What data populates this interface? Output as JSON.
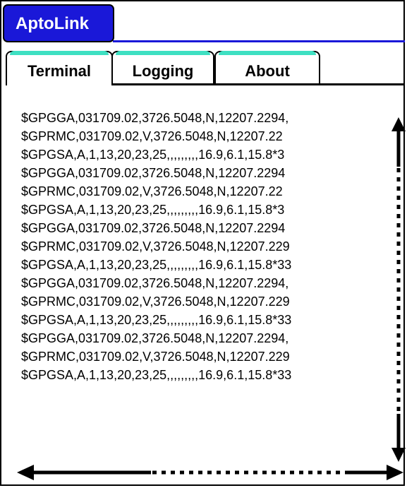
{
  "app": {
    "title": "AptoLink"
  },
  "tabs": [
    {
      "label": "Terminal",
      "active": true
    },
    {
      "label": "Logging",
      "active": false
    },
    {
      "label": "About",
      "active": false
    }
  ],
  "terminal": {
    "lines": [
      "$GPGGA,031709.02,3726.5048,N,12207.2294,",
      "$GPRMC,031709.02,V,3726.5048,N,12207.22",
      "$GPGSA,A,1,13,20,23,25,,,,,,,,,16.9,6.1,15.8*3",
      "$GPGGA,031709.02,3726.5048,N,12207.2294",
      "$GPRMC,031709.02,V,3726.5048,N,12207.22",
      "$GPGSA,A,1,13,20,23,25,,,,,,,,,16.9,6.1,15.8*3",
      "$GPGGA,031709.02,3726.5048,N,12207.2294",
      "$GPRMC,031709.02,V,3726.5048,N,12207.229",
      "$GPGSA,A,1,13,20,23,25,,,,,,,,,16.9,6.1,15.8*33",
      "$GPGGA,031709.02,3726.5048,N,12207.2294,",
      "$GPRMC,031709.02,V,3726.5048,N,12207.229",
      "$GPGSA,A,1,13,20,23,25,,,,,,,,,16.9,6.1,15.8*33",
      "$GPGGA,031709.02,3726.5048,N,12207.2294,",
      "$GPRMC,031709.02,V,3726.5048,N,12207.229",
      "$GPGSA,A,1,13,20,23,25,,,,,,,,,16.9,6.1,15.8*33"
    ]
  },
  "colors": {
    "header_bg": "#1a18d8",
    "tab_accent": "#3ee0c2"
  }
}
